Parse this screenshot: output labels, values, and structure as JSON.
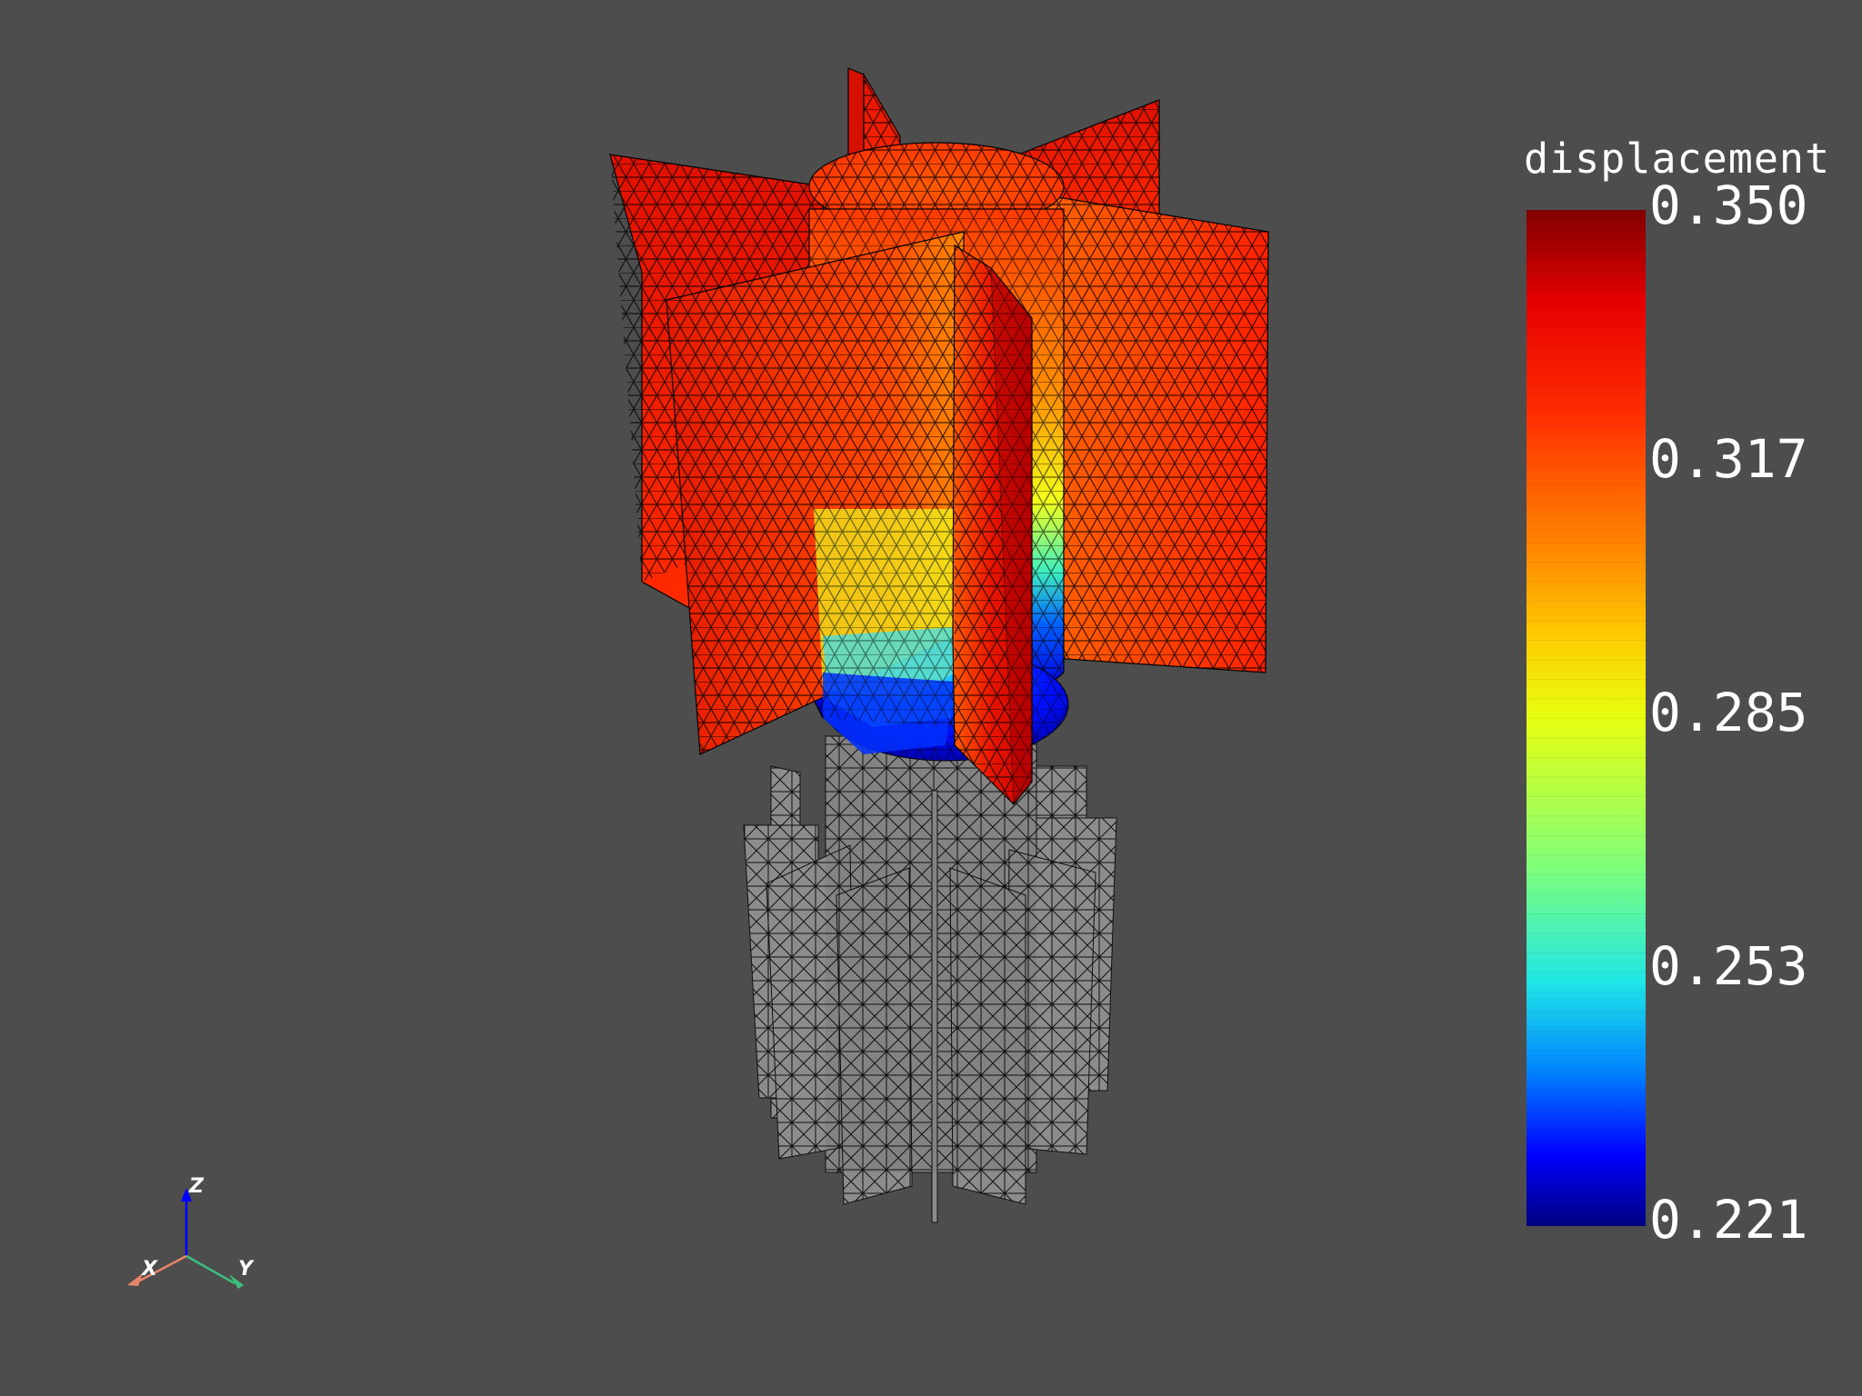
{
  "scalar_bar": {
    "title": "displacement",
    "labels": [
      "0.350",
      "0.317",
      "0.285",
      "0.253",
      "0.221"
    ],
    "colormap": "jet",
    "max": 0.35,
    "min": 0.221
  },
  "axes_widget": {
    "x_label": "X",
    "y_label": "Y",
    "z_label": "Z",
    "x_color": "#e8846a",
    "y_color": "#3fbf7f",
    "z_color": "#0000ff"
  },
  "colors": {
    "background": "#4d4d4d",
    "undeformed_mesh": "#8c8c8c",
    "mesh_edges": "#000000"
  }
}
